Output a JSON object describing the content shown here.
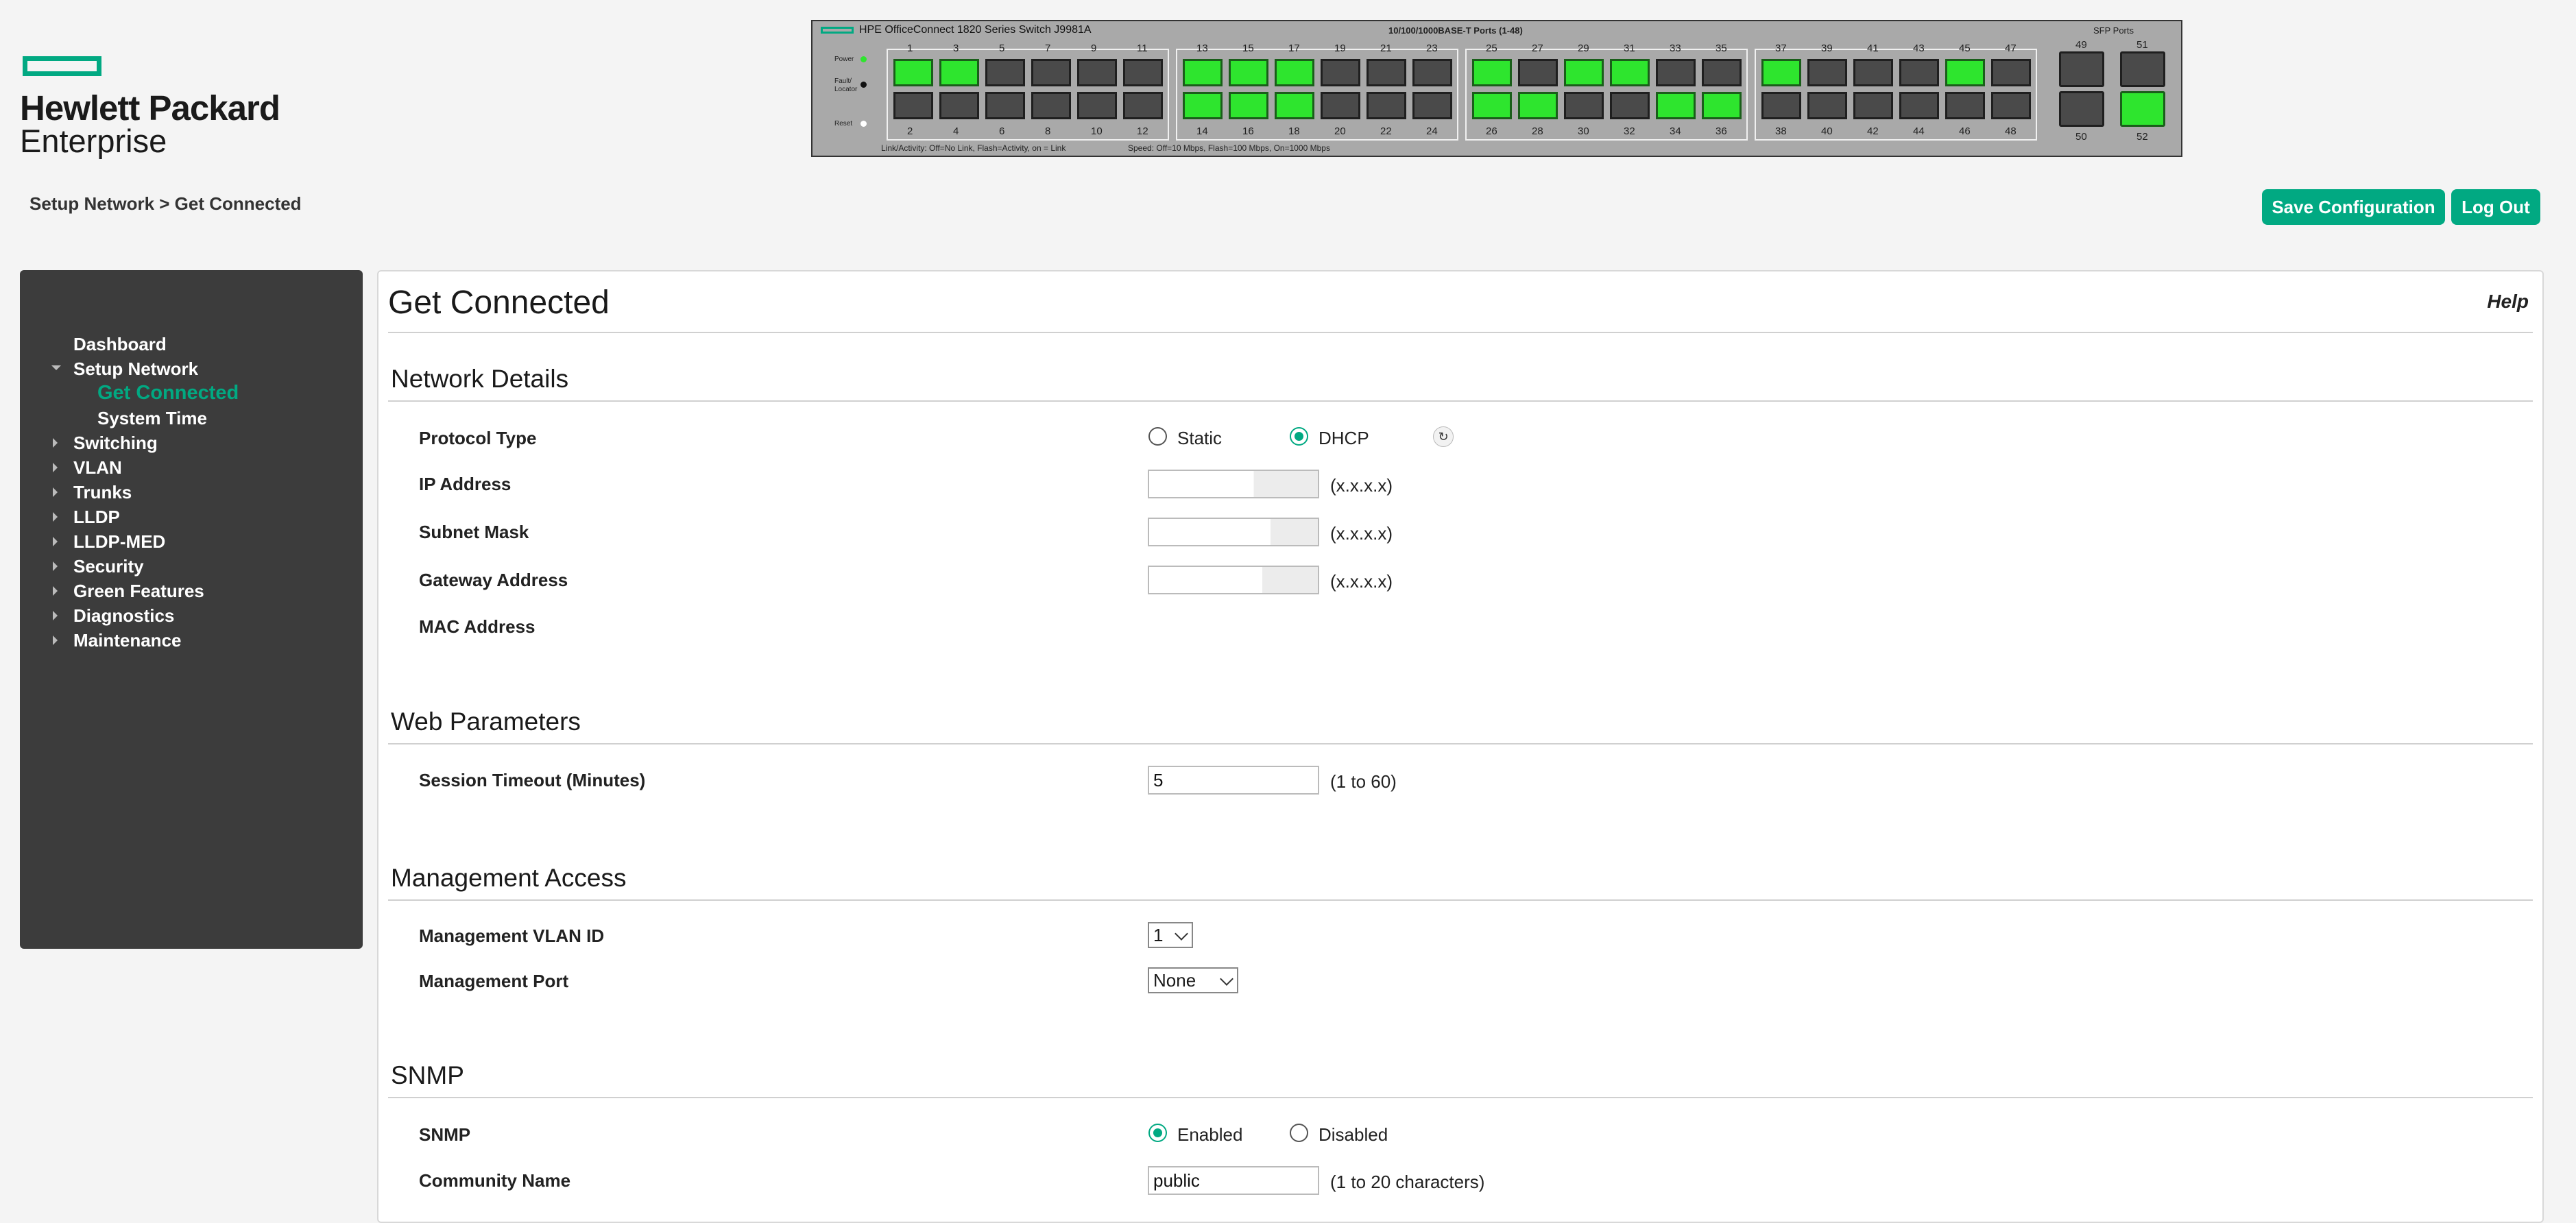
{
  "brand": {
    "line1": "Hewlett Packard",
    "line2": "Enterprise",
    "accent_color": "#01a982"
  },
  "breadcrumb": "Setup Network > Get Connected",
  "header_buttons": {
    "save": "Save Configuration",
    "logout": "Log Out"
  },
  "switch_panel": {
    "title": "HPE OfficeConnect 1820 Series Switch J9981A",
    "ports_label": "10/100/1000BASE-T Ports (1-48)",
    "sfp_label": "SFP Ports",
    "leds": [
      "Power",
      "Fault/ Locator",
      "Reset"
    ],
    "footer_link": "Link/Activity: Off=No Link, Flash=Activity, on = Link",
    "footer_speed": "Speed: Off=10 Mbps, Flash=100 Mbps, On=1000 Mbps",
    "top_active_ports": [
      1,
      3,
      13,
      15,
      17,
      25,
      29,
      31,
      37,
      45
    ],
    "bottom_active_ports": [
      14,
      16,
      18,
      26,
      28,
      34,
      36
    ],
    "sfp_active_ports": [
      52
    ]
  },
  "sidebar": {
    "items": [
      {
        "label": "Dashboard",
        "type": "top",
        "caret": "none"
      },
      {
        "label": "Setup Network",
        "type": "top",
        "caret": "open"
      },
      {
        "label": "Get Connected",
        "type": "sub",
        "active": true
      },
      {
        "label": "System Time",
        "type": "sub",
        "active": false
      },
      {
        "label": "Switching",
        "type": "top",
        "caret": "closed"
      },
      {
        "label": "VLAN",
        "type": "top",
        "caret": "closed"
      },
      {
        "label": "Trunks",
        "type": "top",
        "caret": "closed"
      },
      {
        "label": "LLDP",
        "type": "top",
        "caret": "closed"
      },
      {
        "label": "LLDP-MED",
        "type": "top",
        "caret": "closed"
      },
      {
        "label": "Security",
        "type": "top",
        "caret": "closed"
      },
      {
        "label": "Green Features",
        "type": "top",
        "caret": "closed"
      },
      {
        "label": "Diagnostics",
        "type": "top",
        "caret": "closed"
      },
      {
        "label": "Maintenance",
        "type": "top",
        "caret": "closed"
      }
    ]
  },
  "main": {
    "title": "Get Connected",
    "help": "Help",
    "network_details": {
      "title": "Network Details",
      "protocol_label": "Protocol Type",
      "protocol_options": [
        "Static",
        "DHCP"
      ],
      "protocol_selected": "DHCP",
      "ip_label": "IP Address",
      "ip_hint": "(x.x.x.x)",
      "subnet_label": "Subnet Mask",
      "subnet_hint": "(x.x.x.x)",
      "gateway_label": "Gateway Address",
      "gateway_hint": "(x.x.x.x)",
      "mac_label": "MAC Address"
    },
    "web_parameters": {
      "title": "Web Parameters",
      "timeout_label": "Session Timeout  (Minutes)",
      "timeout_value": "5",
      "timeout_hint": "(1 to 60)"
    },
    "management_access": {
      "title": "Management Access",
      "vlan_label": "Management VLAN ID",
      "vlan_value": "1",
      "port_label": "Management Port",
      "port_value": "None"
    },
    "snmp": {
      "title": "SNMP",
      "snmp_label": "SNMP",
      "options": [
        "Enabled",
        "Disabled"
      ],
      "selected": "Enabled",
      "community_label": "Community Name",
      "community_value": "public",
      "community_hint": "(1 to 20 characters)"
    }
  }
}
